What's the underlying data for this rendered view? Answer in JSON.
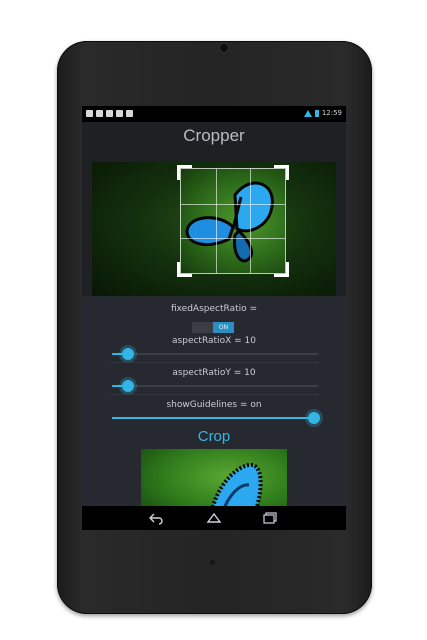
{
  "status_bar": {
    "time": "12:59"
  },
  "app": {
    "title": "Cropper"
  },
  "controls": {
    "fixed_aspect_label": "fixedAspectRatio =",
    "toggle_on_label": "ON",
    "aspect_x_label": "aspectRatioX = 10",
    "aspect_y_label": "aspectRatioY = 10",
    "show_guidelines_label": "showGuidelines = on",
    "aspect_x_level": 0.08,
    "aspect_y_level": 0.08,
    "guidelines_level": 0.98
  },
  "crop_button": {
    "label": "Crop"
  },
  "colors": {
    "accent": "#33b5e5",
    "background": "#1e2024",
    "panel": "#262a30"
  },
  "icons": {
    "nav": [
      "back-icon",
      "home-icon",
      "recent-apps-icon"
    ]
  }
}
